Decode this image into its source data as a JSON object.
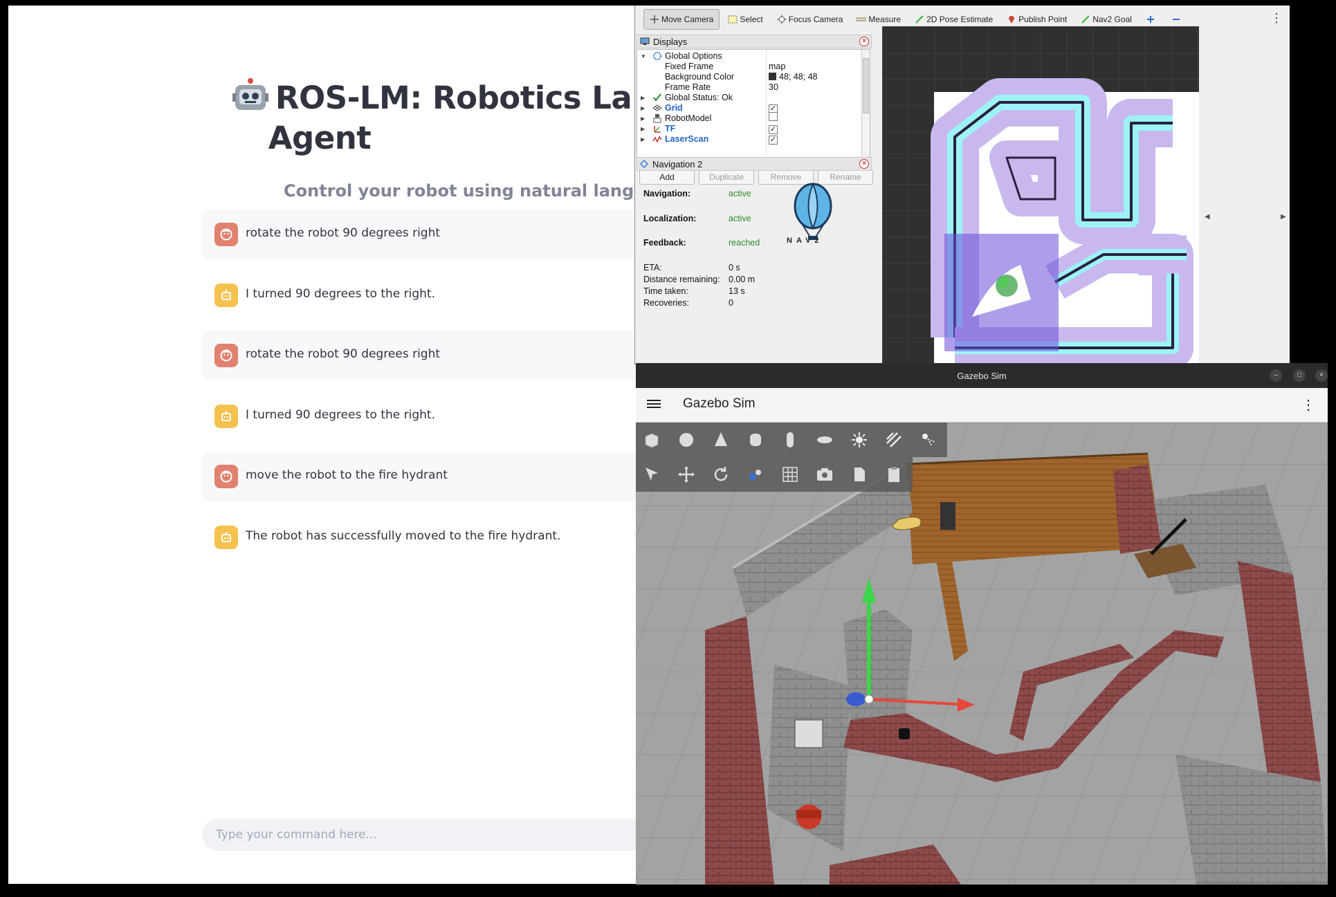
{
  "chat": {
    "title": "ROS-LM: Robotics Langu",
    "title_line2": "Agent",
    "subtitle": "Control your robot using natural language",
    "messages": [
      {
        "role": "user",
        "text": "rotate the robot 90 degrees right"
      },
      {
        "role": "assistant",
        "text": "I turned 90 degrees to the right."
      },
      {
        "role": "user",
        "text": "rotate the robot 90 degrees right"
      },
      {
        "role": "assistant",
        "text": "I turned 90 degrees to the right."
      },
      {
        "role": "user",
        "text": "move the robot to the fire hydrant"
      },
      {
        "role": "assistant",
        "text": "The robot has successfully moved to the fire hydrant."
      }
    ],
    "input_placeholder": "Type your command here..."
  },
  "rviz": {
    "tools": [
      "Move Camera",
      "Select",
      "Focus Camera",
      "Measure",
      "2D Pose Estimate",
      "Publish Point",
      "Nav2 Goal"
    ],
    "displays_title": "Displays",
    "tree": [
      {
        "label": "Global Options",
        "value": ""
      },
      {
        "label": "Fixed Frame",
        "value": "map"
      },
      {
        "label": "Background Color",
        "value": "48; 48; 48"
      },
      {
        "label": "Frame Rate",
        "value": "30"
      },
      {
        "label": "Global Status: Ok",
        "value": ""
      },
      {
        "label": "Grid",
        "checked": true
      },
      {
        "label": "RobotModel",
        "checked": false
      },
      {
        "label": "TF",
        "checked": true
      },
      {
        "label": "LaserScan",
        "checked": true
      }
    ],
    "buttons": [
      "Add",
      "Duplicate",
      "Remove",
      "Rename"
    ],
    "nav2": {
      "title": "Navigation 2",
      "navigation_label": "Navigation:",
      "navigation_value": "active",
      "localization_label": "Localization:",
      "localization_value": "active",
      "feedback_label": "Feedback:",
      "feedback_value": "reached",
      "eta_label": "ETA:",
      "eta_value": "0 s",
      "distance_label": "Distance remaining:",
      "distance_value": "0.00 m",
      "time_label": "Time taken:",
      "time_value": "13 s",
      "recoveries_label": "Recoveries:",
      "recoveries_value": "0",
      "logo_text": "NAV2"
    }
  },
  "gazebo": {
    "window_title": "Gazebo Sim",
    "app_title": "Gazebo Sim"
  }
}
